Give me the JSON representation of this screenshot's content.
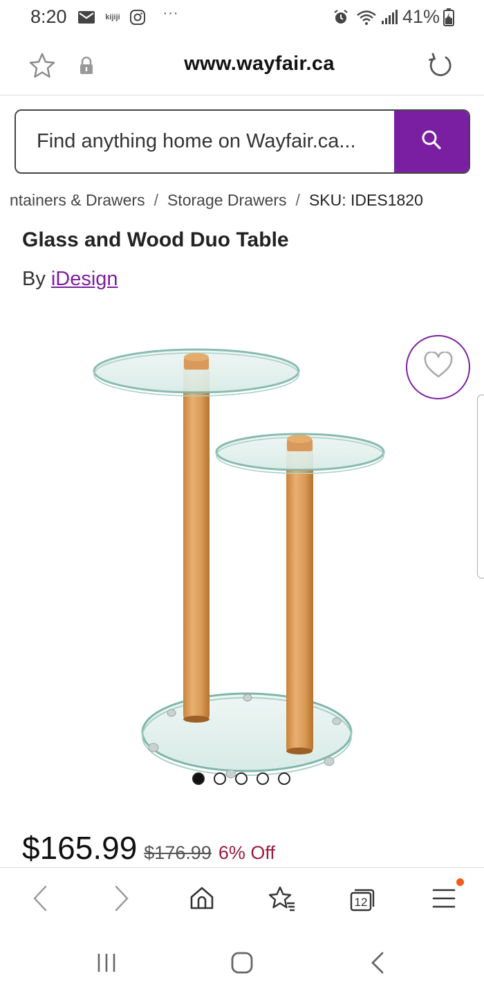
{
  "status_bar": {
    "time": "8:20",
    "notification_icons": [
      "mail-icon",
      "kijiji-icon",
      "instagram-icon",
      "more-icon"
    ],
    "kijiji_label": "kijiji",
    "more_label": "···",
    "system_icons": [
      "alarm-icon",
      "wifi-icon",
      "signal-icon",
      "battery-icon"
    ],
    "battery": "41%"
  },
  "browser": {
    "url": "www.wayfair.ca"
  },
  "search": {
    "placeholder": "Find anything home on Wayfair.ca..."
  },
  "breadcrumb": {
    "items": [
      "ntainers & Drawers",
      "Storage Drawers",
      "SKU: IDES1820"
    ],
    "separator": "/"
  },
  "product": {
    "title": "Glass and Wood Duo Table",
    "by_label": "By",
    "brand": "iDesign",
    "image_count": 5,
    "active_image": 1,
    "price": "$165.99",
    "old_price": "$176.99",
    "discount": "6% Off"
  },
  "browser_toolbar": {
    "tab_count": "12"
  },
  "colors": {
    "brand_purple": "#7b1fa2",
    "discount_red": "#9b1b3a",
    "notification_orange": "#f25a1d"
  }
}
